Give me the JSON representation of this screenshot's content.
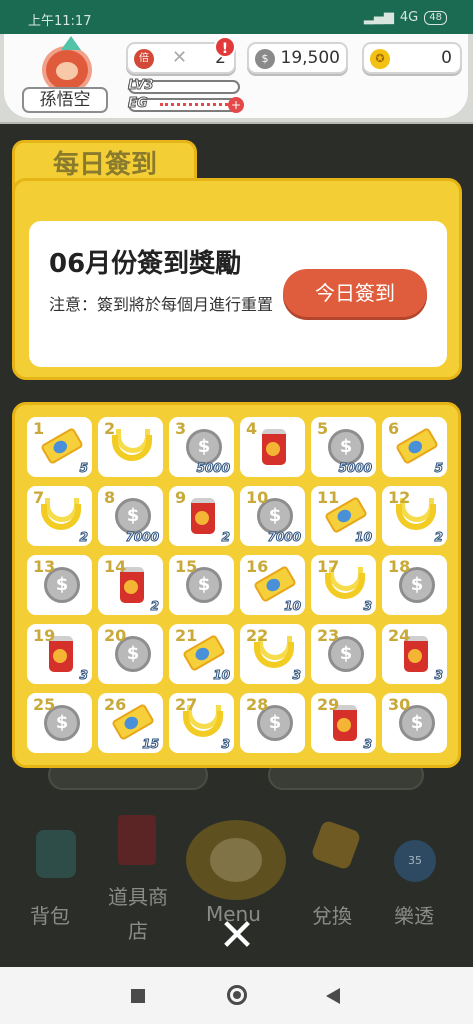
{
  "status": {
    "time": "上午11:17",
    "network": "4G",
    "battery": "48"
  },
  "profile": {
    "name": "孫悟空",
    "level": "LV3",
    "eg_label": "EG"
  },
  "currencies": {
    "multiplier_icon": "倍",
    "multiplier_x": "✕",
    "multiplier_value": "2",
    "alert": "!",
    "silver_icon": "$",
    "silver_value": "19,500",
    "gold_icon": "✪",
    "gold_value": "0"
  },
  "signin": {
    "tab_label": "每日簽到",
    "title": "06月份簽到獎勵",
    "note": "注意：簽到將於每個月進行重置",
    "button": "今日簽到"
  },
  "rewards": [
    {
      "day": "1",
      "type": "ticket",
      "qty": "5"
    },
    {
      "day": "2",
      "type": "banana",
      "qty": ""
    },
    {
      "day": "3",
      "type": "coin",
      "qty": "5000"
    },
    {
      "day": "4",
      "type": "can",
      "qty": ""
    },
    {
      "day": "5",
      "type": "coin",
      "qty": "5000"
    },
    {
      "day": "6",
      "type": "ticket",
      "qty": "5"
    },
    {
      "day": "7",
      "type": "banana",
      "qty": "2"
    },
    {
      "day": "8",
      "type": "coin",
      "qty": "7000"
    },
    {
      "day": "9",
      "type": "can",
      "qty": "2"
    },
    {
      "day": "10",
      "type": "coin",
      "qty": "7000"
    },
    {
      "day": "11",
      "type": "ticket",
      "qty": "10"
    },
    {
      "day": "12",
      "type": "banana",
      "qty": "2"
    },
    {
      "day": "13",
      "type": "coin",
      "qty": ""
    },
    {
      "day": "14",
      "type": "can",
      "qty": "2"
    },
    {
      "day": "15",
      "type": "coin",
      "qty": ""
    },
    {
      "day": "16",
      "type": "ticket",
      "qty": "10"
    },
    {
      "day": "17",
      "type": "banana",
      "qty": "3"
    },
    {
      "day": "18",
      "type": "coin",
      "qty": ""
    },
    {
      "day": "19",
      "type": "can",
      "qty": "3"
    },
    {
      "day": "20",
      "type": "coin",
      "qty": ""
    },
    {
      "day": "21",
      "type": "ticket",
      "qty": "10"
    },
    {
      "day": "22",
      "type": "banana",
      "qty": "3"
    },
    {
      "day": "23",
      "type": "coin",
      "qty": ""
    },
    {
      "day": "24",
      "type": "can",
      "qty": "3"
    },
    {
      "day": "25",
      "type": "coin",
      "qty": ""
    },
    {
      "day": "26",
      "type": "ticket",
      "qty": "15"
    },
    {
      "day": "27",
      "type": "banana",
      "qty": "3"
    },
    {
      "day": "28",
      "type": "coin",
      "qty": ""
    },
    {
      "day": "29",
      "type": "can",
      "qty": "3"
    },
    {
      "day": "30",
      "type": "coin",
      "qty": ""
    }
  ],
  "bottom_menu": {
    "bag": "背包",
    "shop": "道具商店",
    "menu": "Menu",
    "exchange": "兌換",
    "lotto": "樂透",
    "lotto_badge": "35"
  },
  "close": "✕",
  "colors": {
    "accent": "#f3cf35",
    "button": "#df5d3c",
    "statusbar": "#1b6b52"
  }
}
